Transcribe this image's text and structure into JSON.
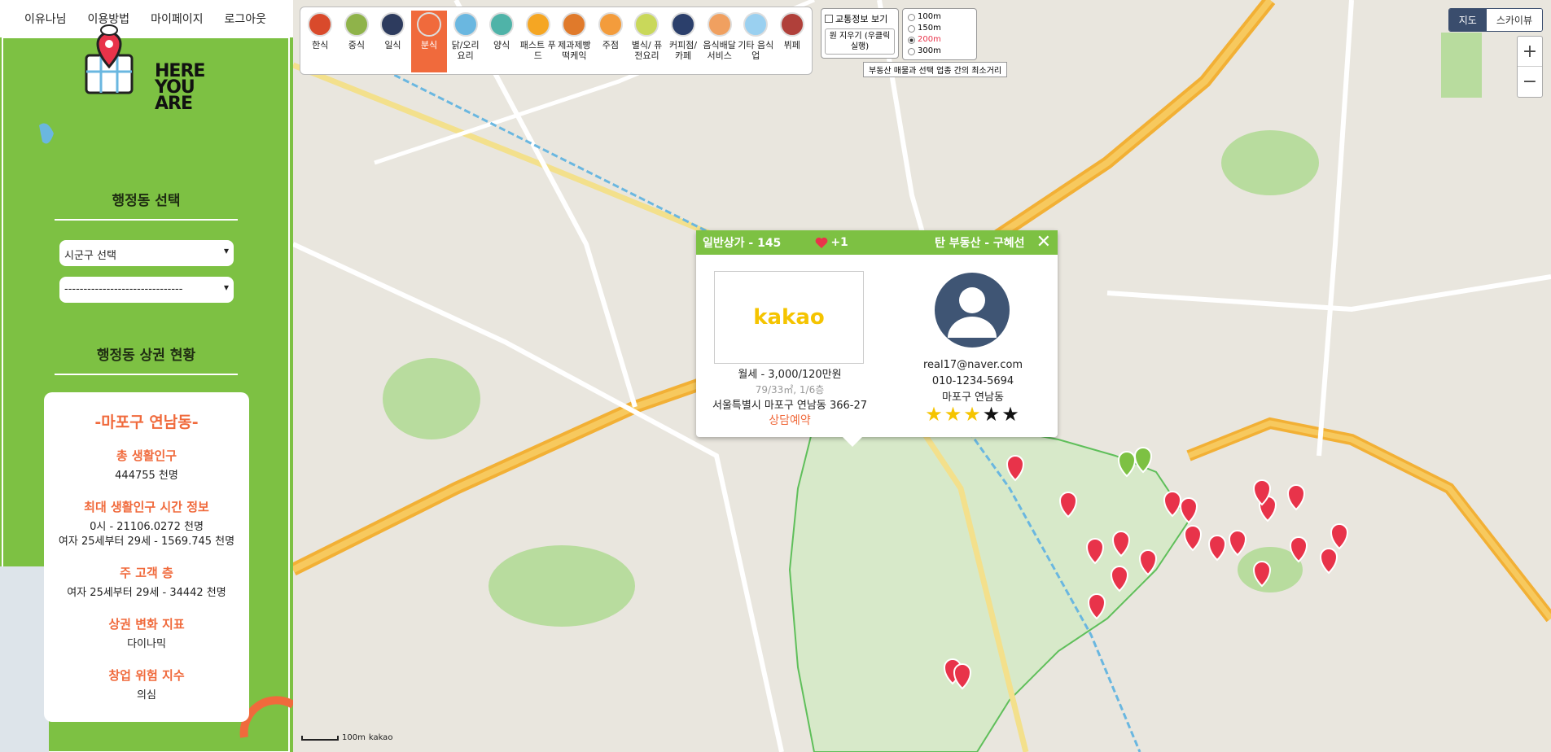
{
  "topnav": {
    "intro": "이유나님",
    "howto": "이용방법",
    "mypage": "마이페이지",
    "logout": "로그아웃"
  },
  "logo": {
    "line1": "HERE",
    "line2": "YOU",
    "line3": "ARE"
  },
  "sidebar": {
    "select_heading": "행정동 선택",
    "gu_select": "시군구 선택",
    "dong_select": "-------------------------------",
    "status_heading": "행정동 상권 현황",
    "dong_name": "-마포구 연남동-",
    "stats": [
      {
        "label": "총 생활인구",
        "value": "444755 천명"
      },
      {
        "label": "최대 생활인구 시간 정보",
        "value": "0시 - 21106.0272 천명",
        "value2": "여자 25세부터 29세 - 1569.745 천명"
      },
      {
        "label": "주 고객 층",
        "value": "여자 25세부터 29세 - 34442 천명"
      },
      {
        "label": "상권 변화 지표",
        "value": "다이나믹"
      },
      {
        "label": "창업 위험 지수",
        "value": "의심"
      }
    ]
  },
  "categories": [
    {
      "label": "한식",
      "color": "#d94a2b"
    },
    {
      "label": "중식",
      "color": "#8fb34a"
    },
    {
      "label": "일식",
      "color": "#2d3b5e"
    },
    {
      "label": "분식",
      "color": "#f06a3c",
      "active": true
    },
    {
      "label": "닭/오리 요리",
      "color": "#6ab7e0"
    },
    {
      "label": "양식",
      "color": "#4fb3a8"
    },
    {
      "label": "패스트 푸드",
      "color": "#f5a623"
    },
    {
      "label": "제과제빵 떡케익",
      "color": "#e07a2b"
    },
    {
      "label": "주점",
      "color": "#f39c3c"
    },
    {
      "label": "별식/ 퓨전요리",
      "color": "#c9d85a"
    },
    {
      "label": "커피점/ 카페",
      "color": "#2b3f6b"
    },
    {
      "label": "음식배달 서비스",
      "color": "#f0a060"
    },
    {
      "label": "기타 음식업",
      "color": "#9ad0f0"
    },
    {
      "label": "뷔페",
      "color": "#b0403a"
    }
  ],
  "map_controls": {
    "traffic_label": "교통정보 보기",
    "clear_label": "원 지우기 (우클릭 실행)",
    "radius_options": [
      "100m",
      "150m",
      "200m",
      "300m"
    ],
    "radius_selected": "200m",
    "radius_tip": "부동산 매물과 선택 업종 간의 최소거리",
    "maptype_map": "지도",
    "maptype_sky": "스카이뷰",
    "zoom_in": "+",
    "zoom_out": "−",
    "scale": "100m",
    "provider": "kakao"
  },
  "popup": {
    "title": "일반상가 - 145",
    "likes": "+1",
    "agent": "탄 부동산 - 구혜선",
    "image_text": "kakao",
    "price": "월세 - 3,000/120만원",
    "area": "79/33㎡, 1/6층",
    "address": "서울특별시 마포구 연남동 366-27",
    "reserve": "상담예약",
    "email": "real17@naver.com",
    "phone": "010-1234-5694",
    "region": "마포구 연남동",
    "rating": 3,
    "rating_max": 5
  },
  "colors": {
    "sidebar_green": "#7dc143",
    "accent_orange": "#f06a3c",
    "marker_red": "#e8334a",
    "marker_green": "#7dc143"
  }
}
